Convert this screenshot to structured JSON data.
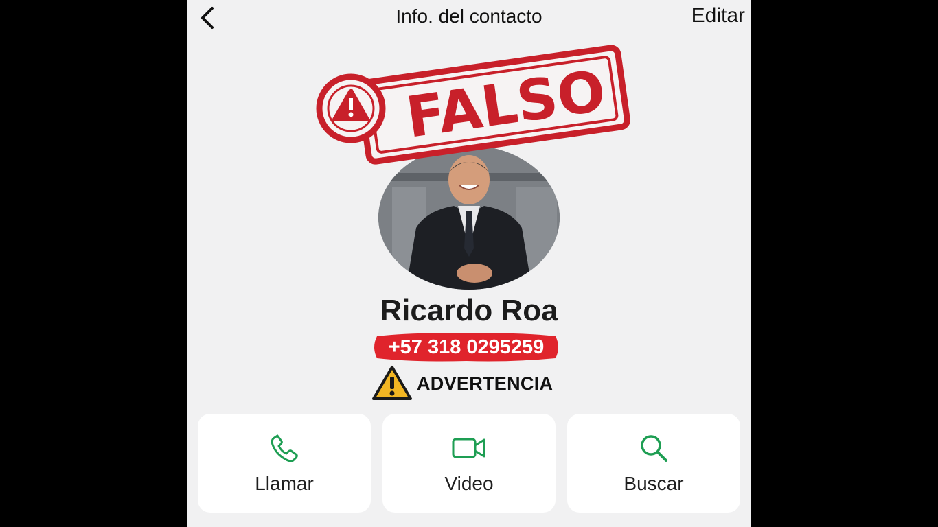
{
  "header": {
    "back_icon": "chevron-left-icon",
    "title": "Info. del contacto",
    "edit_label": "Editar"
  },
  "stamp": {
    "text": "FALSO",
    "icon": "alert-icon",
    "color": "#c8202a"
  },
  "contact": {
    "name": "Ricardo Roa",
    "phone": "+57 318 0295259"
  },
  "warning": {
    "icon": "warning-triangle-icon",
    "text": "ADVERTENCIA"
  },
  "actions": [
    {
      "label": "Llamar",
      "icon": "phone-icon"
    },
    {
      "label": "Video",
      "icon": "video-camera-icon"
    },
    {
      "label": "Buscar",
      "icon": "search-icon"
    }
  ],
  "colors": {
    "accent_green": "#1e9e53",
    "stamp_red": "#c8202a",
    "phone_highlight": "#e0242c"
  }
}
